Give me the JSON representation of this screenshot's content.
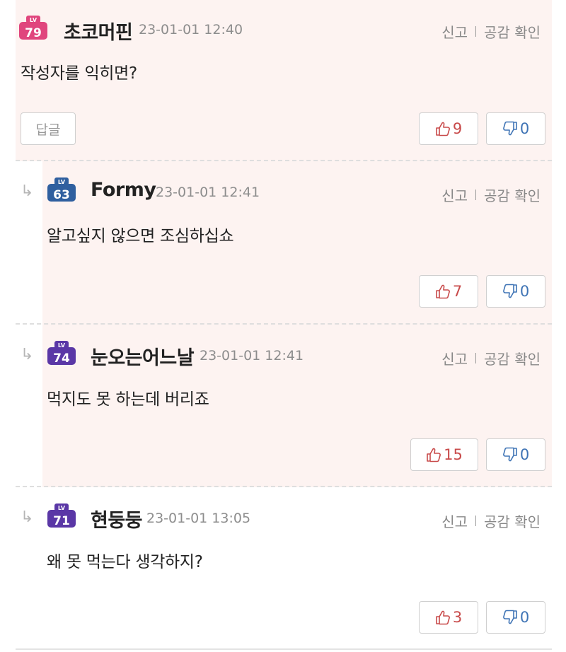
{
  "comments": [
    {
      "level": "79",
      "badge_color": "#e0457d",
      "nickname": "초코머핀",
      "date": "23-01-01 12:40",
      "report": "신고",
      "sympathy": "공감 확인",
      "body": "작성자를 익히면?",
      "reply_label": "답글",
      "up": "9",
      "down": "0"
    },
    {
      "level": "63",
      "badge_color": "#2f5f9f",
      "nickname": "Formy",
      "date": "23-01-01 12:41",
      "report": "신고",
      "sympathy": "공감 확인",
      "body": "알고싶지 않으면 조심하십쇼",
      "up": "7",
      "down": "0"
    },
    {
      "level": "74",
      "badge_color": "#5a37a6",
      "nickname": "눈오는어느날",
      "date": "23-01-01 12:41",
      "report": "신고",
      "sympathy": "공감 확인",
      "body": "먹지도 못 하는데 버리죠",
      "up": "15",
      "down": "0"
    },
    {
      "level": "71",
      "badge_color": "#5a37a6",
      "nickname": "현둥둥",
      "date": "23-01-01 13:05",
      "report": "신고",
      "sympathy": "공감 확인",
      "body": "왜 못 먹는다 생각하지?",
      "up": "3",
      "down": "0"
    }
  ],
  "colors": {
    "highlight_bg": "#fdf3f1",
    "upvote": "#c84a4a",
    "downvote": "#3f74b5"
  },
  "icons": {
    "reply_arrow": "reply-arrow-icon",
    "thumbs_up": "thumbs-up-icon",
    "thumbs_down": "thumbs-down-icon",
    "level_badge": "level-badge-icon"
  },
  "badge_text": "LV"
}
